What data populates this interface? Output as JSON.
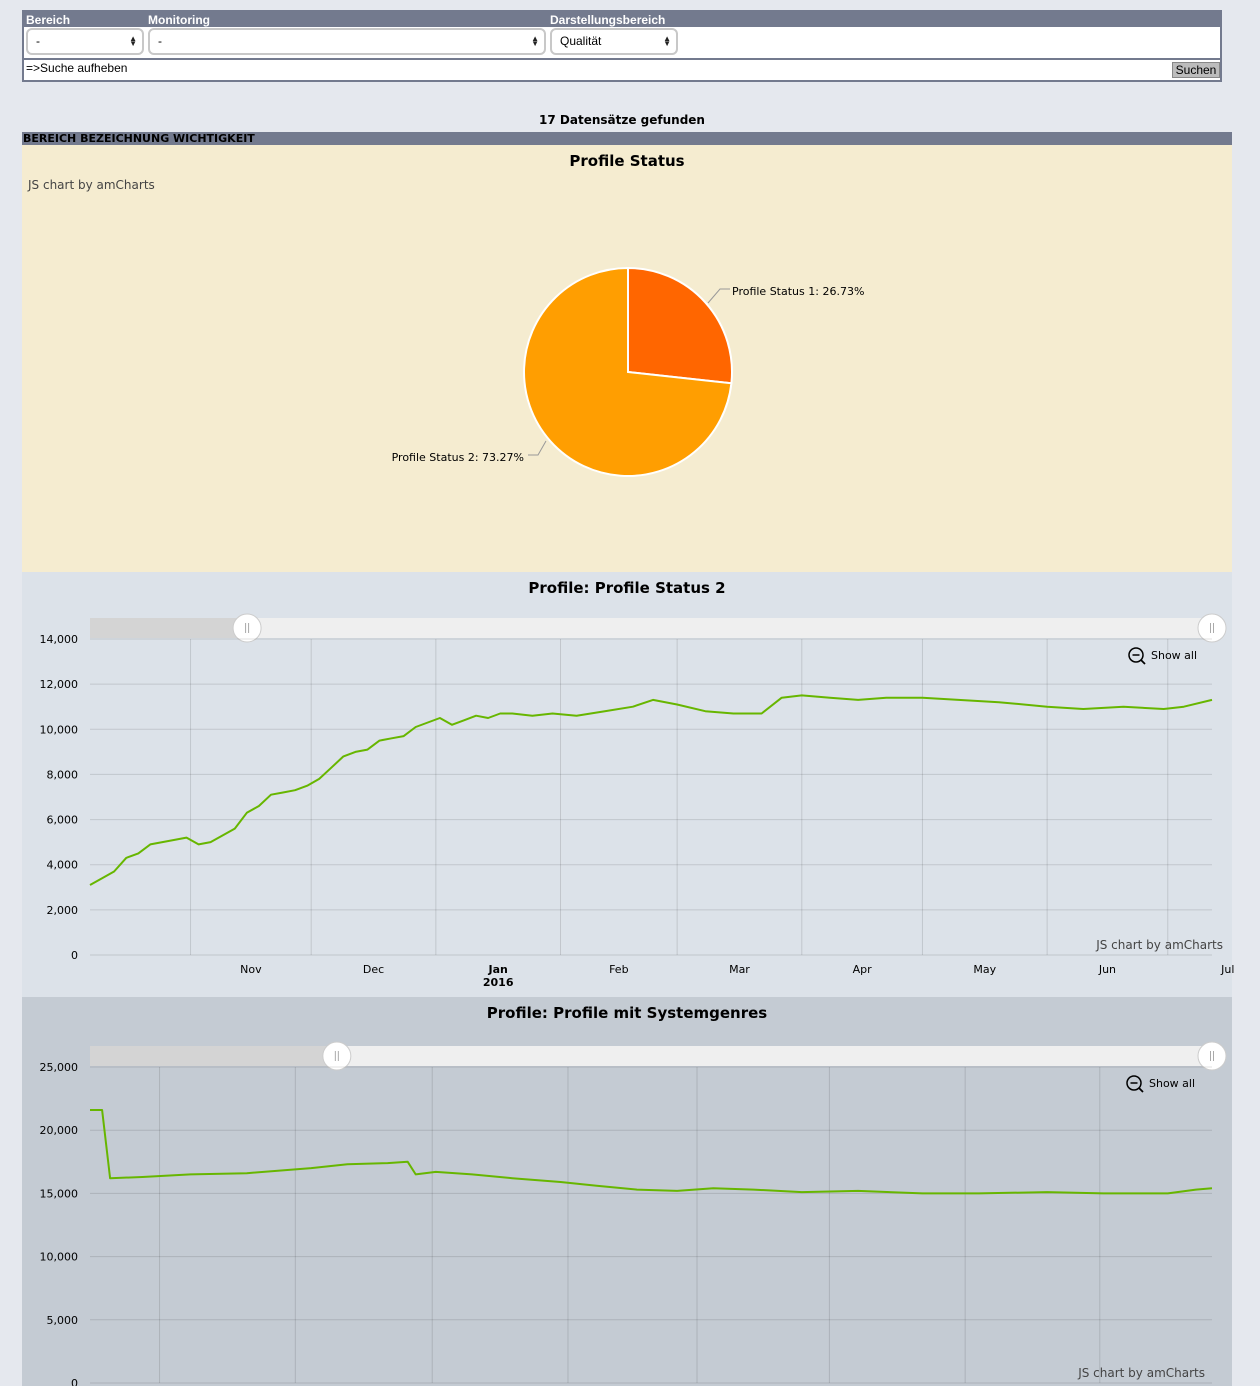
{
  "filter": {
    "bereich_label": "Bereich",
    "monitoring_label": "Monitoring",
    "darstellung_label": "Darstellungsbereich",
    "bereich_value": "-",
    "monitoring_value": "-",
    "darstellung_value": "Qualität",
    "reset_link": "=>Suche aufheben",
    "search_button": "Suchen"
  },
  "results": {
    "count_text": "17 Datensätze gefunden",
    "column_header": "BEREICH BEZEICHNUNG WICHTIGKEIT"
  },
  "colors": {
    "pie_slice_1": "#ff6600",
    "pie_slice_2": "#ff9e01",
    "line": "#67b600"
  },
  "chart_data": [
    {
      "type": "pie",
      "title": "Profile Status",
      "credit": "JS chart by amCharts",
      "slices": [
        {
          "label": "Profile Status 1: 26.73%",
          "name": "Profile Status 1",
          "value": 26.73
        },
        {
          "label": "Profile Status 2: 73.27%",
          "name": "Profile Status 2",
          "value": 73.27
        }
      ]
    },
    {
      "type": "line",
      "title": "Profile: Profile Status 2",
      "credit": "JS chart by amCharts",
      "show_all": "Show all",
      "ylim": [
        0,
        14000
      ],
      "yticks": [
        "0",
        "2,000",
        "4,000",
        "6,000",
        "8,000",
        "10,000",
        "12,000",
        "14,000"
      ],
      "yvalues": [
        0,
        2000,
        4000,
        6000,
        8000,
        10000,
        12000,
        14000
      ],
      "xticks": [
        "Nov",
        "Dec",
        "Jan",
        "Feb",
        "Mar",
        "Apr",
        "May",
        "Jun",
        "Jul"
      ],
      "xtick_bold": "Jan",
      "xtick_year": "2016",
      "x_range": [
        "2015-10-07",
        "2016-07-12"
      ],
      "xtick_dates": [
        "2015-11-01",
        "2015-12-01",
        "2016-01-01",
        "2016-02-01",
        "2016-03-01",
        "2016-04-01",
        "2016-05-01",
        "2016-06-01",
        "2016-07-01"
      ],
      "scrollbar": [
        0.14,
        1.0
      ],
      "series": [
        {
          "x": [
            "2015-10-07",
            "2015-10-10",
            "2015-10-13",
            "2015-10-16",
            "2015-10-19",
            "2015-10-22",
            "2015-10-25",
            "2015-10-28",
            "2015-10-31",
            "2015-11-03",
            "2015-11-06",
            "2015-11-09",
            "2015-11-12",
            "2015-11-15",
            "2015-11-18",
            "2015-11-21",
            "2015-11-24",
            "2015-11-27",
            "2015-11-30",
            "2015-12-03",
            "2015-12-06",
            "2015-12-09",
            "2015-12-12",
            "2015-12-15",
            "2015-12-18",
            "2015-12-21",
            "2015-12-24",
            "2015-12-27",
            "2015-12-30",
            "2016-01-02",
            "2016-01-05",
            "2016-01-08",
            "2016-01-11",
            "2016-01-14",
            "2016-01-17",
            "2016-01-20",
            "2016-01-25",
            "2016-01-30",
            "2016-02-05",
            "2016-02-12",
            "2016-02-19",
            "2016-02-24",
            "2016-03-01",
            "2016-03-08",
            "2016-03-15",
            "2016-03-22",
            "2016-03-27",
            "2016-04-01",
            "2016-04-08",
            "2016-04-15",
            "2016-04-22",
            "2016-05-01",
            "2016-05-10",
            "2016-05-20",
            "2016-06-01",
            "2016-06-10",
            "2016-06-20",
            "2016-06-30",
            "2016-07-05",
            "2016-07-12"
          ],
          "values": [
            3100,
            3400,
            3700,
            4300,
            4500,
            4900,
            5000,
            5100,
            5200,
            4900,
            5000,
            5300,
            5600,
            6300,
            6600,
            7100,
            7200,
            7300,
            7500,
            7800,
            8300,
            8800,
            9000,
            9100,
            9500,
            9600,
            9700,
            10100,
            10300,
            10500,
            10200,
            10400,
            10600,
            10500,
            10700,
            10700,
            10600,
            10700,
            10600,
            10800,
            11000,
            11300,
            11100,
            10800,
            10700,
            10700,
            11400,
            11500,
            11400,
            11300,
            11400,
            11400,
            11300,
            11200,
            11000,
            10900,
            11000,
            10900,
            11000,
            11300
          ]
        }
      ]
    },
    {
      "type": "line",
      "title": "Profile: Profile mit Systemgenres",
      "credit": "JS chart by amCharts",
      "show_all": "Show all",
      "ylim": [
        0,
        25000
      ],
      "yticks": [
        "0",
        "5,000",
        "10,000",
        "15,000",
        "20,000",
        "25,000"
      ],
      "yvalues": [
        0,
        5000,
        10000,
        15000,
        20000,
        25000
      ],
      "x_range": [
        "2015-10-07",
        "2016-07-12"
      ],
      "scrollbar": [
        0.22,
        1.0
      ],
      "series": [
        {
          "x": [
            "2015-10-07",
            "2015-10-10",
            "2015-10-12",
            "2015-10-20",
            "2015-11-01",
            "2015-11-15",
            "2015-12-01",
            "2015-12-10",
            "2015-12-20",
            "2015-12-25",
            "2015-12-27",
            "2016-01-01",
            "2016-01-10",
            "2016-01-20",
            "2016-02-01",
            "2016-02-10",
            "2016-02-20",
            "2016-03-01",
            "2016-03-10",
            "2016-03-20",
            "2016-04-01",
            "2016-04-15",
            "2016-05-01",
            "2016-05-15",
            "2016-06-01",
            "2016-06-15",
            "2016-07-01",
            "2016-07-08",
            "2016-07-12"
          ],
          "values": [
            21600,
            21600,
            16200,
            16300,
            16500,
            16600,
            17000,
            17300,
            17400,
            17500,
            16500,
            16700,
            16500,
            16200,
            15900,
            15600,
            15300,
            15200,
            15400,
            15300,
            15100,
            15200,
            15000,
            15000,
            15100,
            15000,
            15000,
            15300,
            15400
          ]
        }
      ]
    }
  ]
}
